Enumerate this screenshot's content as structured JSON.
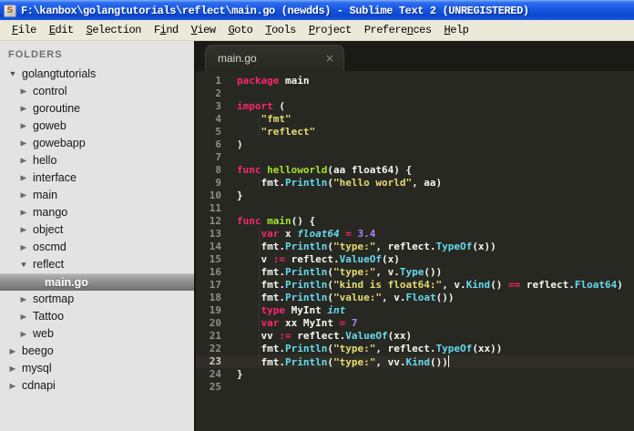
{
  "titlebar": {
    "icon_letter": "S",
    "title": "F:\\kanbox\\golangtutorials\\reflect\\main.go (newdds) - Sublime Text 2 (UNREGISTERED)"
  },
  "menubar": {
    "items": [
      {
        "pre": "",
        "u": "F",
        "post": "ile"
      },
      {
        "pre": "",
        "u": "E",
        "post": "dit"
      },
      {
        "pre": "",
        "u": "S",
        "post": "election"
      },
      {
        "pre": "F",
        "u": "i",
        "post": "nd"
      },
      {
        "pre": "",
        "u": "V",
        "post": "iew"
      },
      {
        "pre": "",
        "u": "G",
        "post": "oto"
      },
      {
        "pre": "",
        "u": "T",
        "post": "ools"
      },
      {
        "pre": "",
        "u": "P",
        "post": "roject"
      },
      {
        "pre": "Prefere",
        "u": "n",
        "post": "ces"
      },
      {
        "pre": "",
        "u": "H",
        "post": "elp"
      }
    ]
  },
  "sidebar": {
    "header": "FOLDERS",
    "items": [
      {
        "label": "golangtutorials",
        "level": 0,
        "type": "expanded",
        "selected": false
      },
      {
        "label": "control",
        "level": 1,
        "type": "collapsed",
        "selected": false
      },
      {
        "label": "goroutine",
        "level": 1,
        "type": "collapsed",
        "selected": false
      },
      {
        "label": "goweb",
        "level": 1,
        "type": "collapsed",
        "selected": false
      },
      {
        "label": "gowebapp",
        "level": 1,
        "type": "collapsed",
        "selected": false
      },
      {
        "label": "hello",
        "level": 1,
        "type": "collapsed",
        "selected": false
      },
      {
        "label": "interface",
        "level": 1,
        "type": "collapsed",
        "selected": false
      },
      {
        "label": "main",
        "level": 1,
        "type": "collapsed",
        "selected": false
      },
      {
        "label": "mango",
        "level": 1,
        "type": "collapsed",
        "selected": false
      },
      {
        "label": "object",
        "level": 1,
        "type": "collapsed",
        "selected": false
      },
      {
        "label": "oscmd",
        "level": 1,
        "type": "collapsed",
        "selected": false
      },
      {
        "label": "reflect",
        "level": 1,
        "type": "expanded",
        "selected": false
      },
      {
        "label": "main.go",
        "level": 2,
        "type": "file",
        "selected": true
      },
      {
        "label": "sortmap",
        "level": 1,
        "type": "collapsed",
        "selected": false
      },
      {
        "label": "Tattoo",
        "level": 1,
        "type": "collapsed",
        "selected": false
      },
      {
        "label": "web",
        "level": 1,
        "type": "collapsed",
        "selected": false
      },
      {
        "label": "beego",
        "level": 0,
        "type": "collapsed",
        "selected": false
      },
      {
        "label": "mysql",
        "level": 0,
        "type": "collapsed",
        "selected": false
      },
      {
        "label": "cdnapi",
        "level": 0,
        "type": "collapsed",
        "selected": false
      }
    ]
  },
  "tabbar": {
    "tabs": [
      {
        "label": "main.go",
        "close_glyph": "×",
        "active": true
      }
    ]
  },
  "editor": {
    "language": "go",
    "current_line": 23,
    "lines": [
      {
        "n": 1,
        "guide": false,
        "tokens": [
          [
            "kw",
            "package"
          ],
          [
            "fg",
            " main"
          ]
        ]
      },
      {
        "n": 2,
        "guide": false,
        "tokens": []
      },
      {
        "n": 3,
        "guide": false,
        "tokens": [
          [
            "kw",
            "import"
          ],
          [
            "fg",
            " ("
          ]
        ]
      },
      {
        "n": 4,
        "guide": true,
        "tokens": [
          [
            "fg",
            "    "
          ],
          [
            "str",
            "\"fmt\""
          ]
        ]
      },
      {
        "n": 5,
        "guide": true,
        "tokens": [
          [
            "fg",
            "    "
          ],
          [
            "str",
            "\"reflect\""
          ]
        ]
      },
      {
        "n": 6,
        "guide": false,
        "tokens": [
          [
            "fg",
            ")"
          ]
        ]
      },
      {
        "n": 7,
        "guide": false,
        "tokens": []
      },
      {
        "n": 8,
        "guide": false,
        "tokens": [
          [
            "kw",
            "func"
          ],
          [
            "fg",
            " "
          ],
          [
            "fn",
            "helloworld"
          ],
          [
            "fg",
            "(aa float64) {"
          ]
        ]
      },
      {
        "n": 9,
        "guide": true,
        "tokens": [
          [
            "fg",
            "    fmt."
          ],
          [
            "call",
            "Println"
          ],
          [
            "fg",
            "("
          ],
          [
            "str",
            "\"hello world\""
          ],
          [
            "fg",
            ", aa)"
          ]
        ]
      },
      {
        "n": 10,
        "guide": false,
        "tokens": [
          [
            "fg",
            "}"
          ]
        ]
      },
      {
        "n": 11,
        "guide": false,
        "tokens": []
      },
      {
        "n": 12,
        "guide": false,
        "tokens": [
          [
            "kw",
            "func"
          ],
          [
            "fg",
            " "
          ],
          [
            "fn",
            "main"
          ],
          [
            "fg",
            "() {"
          ]
        ]
      },
      {
        "n": 13,
        "guide": true,
        "tokens": [
          [
            "fg",
            "    "
          ],
          [
            "kw",
            "var"
          ],
          [
            "fg",
            " x "
          ],
          [
            "typ",
            "float64"
          ],
          [
            "fg",
            " "
          ],
          [
            "kw",
            "="
          ],
          [
            "fg",
            " "
          ],
          [
            "num",
            "3.4"
          ]
        ]
      },
      {
        "n": 14,
        "guide": true,
        "tokens": [
          [
            "fg",
            "    fmt."
          ],
          [
            "call",
            "Println"
          ],
          [
            "fg",
            "("
          ],
          [
            "str",
            "\"type:\""
          ],
          [
            "fg",
            ", reflect."
          ],
          [
            "call",
            "TypeOf"
          ],
          [
            "fg",
            "(x))"
          ]
        ]
      },
      {
        "n": 15,
        "guide": true,
        "tokens": [
          [
            "fg",
            "    v "
          ],
          [
            "kw",
            ":="
          ],
          [
            "fg",
            " reflect."
          ],
          [
            "call",
            "ValueOf"
          ],
          [
            "fg",
            "(x)"
          ]
        ]
      },
      {
        "n": 16,
        "guide": true,
        "tokens": [
          [
            "fg",
            "    fmt."
          ],
          [
            "call",
            "Println"
          ],
          [
            "fg",
            "("
          ],
          [
            "str",
            "\"type:\""
          ],
          [
            "fg",
            ", v."
          ],
          [
            "call",
            "Type"
          ],
          [
            "fg",
            "())"
          ]
        ]
      },
      {
        "n": 17,
        "guide": true,
        "tokens": [
          [
            "fg",
            "    fmt."
          ],
          [
            "call",
            "Println"
          ],
          [
            "fg",
            "("
          ],
          [
            "str",
            "\"kind is float64:\""
          ],
          [
            "fg",
            ", v."
          ],
          [
            "call",
            "Kind"
          ],
          [
            "fg",
            "() "
          ],
          [
            "kw",
            "=="
          ],
          [
            "fg",
            " reflect."
          ],
          [
            "call",
            "Float64"
          ],
          [
            "fg",
            ")"
          ]
        ]
      },
      {
        "n": 18,
        "guide": true,
        "tokens": [
          [
            "fg",
            "    fmt."
          ],
          [
            "call",
            "Println"
          ],
          [
            "fg",
            "("
          ],
          [
            "str",
            "\"value:\""
          ],
          [
            "fg",
            ", v."
          ],
          [
            "call",
            "Float"
          ],
          [
            "fg",
            "())"
          ]
        ]
      },
      {
        "n": 19,
        "guide": true,
        "tokens": [
          [
            "fg",
            "    "
          ],
          [
            "kw",
            "type"
          ],
          [
            "fg",
            " MyInt "
          ],
          [
            "typ",
            "int"
          ]
        ]
      },
      {
        "n": 20,
        "guide": true,
        "tokens": [
          [
            "fg",
            "    "
          ],
          [
            "kw",
            "var"
          ],
          [
            "fg",
            " xx MyInt "
          ],
          [
            "kw",
            "="
          ],
          [
            "fg",
            " "
          ],
          [
            "num",
            "7"
          ]
        ]
      },
      {
        "n": 21,
        "guide": true,
        "tokens": [
          [
            "fg",
            "    vv "
          ],
          [
            "kw",
            ":="
          ],
          [
            "fg",
            " reflect."
          ],
          [
            "call",
            "ValueOf"
          ],
          [
            "fg",
            "(xx)"
          ]
        ]
      },
      {
        "n": 22,
        "guide": true,
        "tokens": [
          [
            "fg",
            "    fmt."
          ],
          [
            "call",
            "Println"
          ],
          [
            "fg",
            "("
          ],
          [
            "str",
            "\"type:\""
          ],
          [
            "fg",
            ", reflect."
          ],
          [
            "call",
            "TypeOf"
          ],
          [
            "fg",
            "(xx))"
          ]
        ]
      },
      {
        "n": 23,
        "guide": true,
        "cursor": true,
        "tokens": [
          [
            "fg",
            "    fmt."
          ],
          [
            "call",
            "Println"
          ],
          [
            "fg",
            "("
          ],
          [
            "str",
            "\"type:\""
          ],
          [
            "fg",
            ", vv."
          ],
          [
            "call",
            "Kind"
          ],
          [
            "fg",
            "())"
          ]
        ]
      },
      {
        "n": 24,
        "guide": false,
        "tokens": [
          [
            "fg",
            "}"
          ]
        ]
      },
      {
        "n": 25,
        "guide": false,
        "tokens": []
      }
    ]
  },
  "colors": {
    "keyword": "#F92672",
    "function": "#A6E22E",
    "string": "#E6DB74",
    "number": "#AE81FF",
    "type": "#66D9EF",
    "call": "#66D9EF",
    "foreground": "#F8F8F2",
    "editor_bg": "#272822",
    "tabbar_bg": "#1A1A16",
    "sidebar_bg": "#E3E3E3",
    "menubar_bg": "#ECE9D8",
    "titlebar_blue": "#1556E0",
    "selection_gray": "#8F8F8F"
  }
}
